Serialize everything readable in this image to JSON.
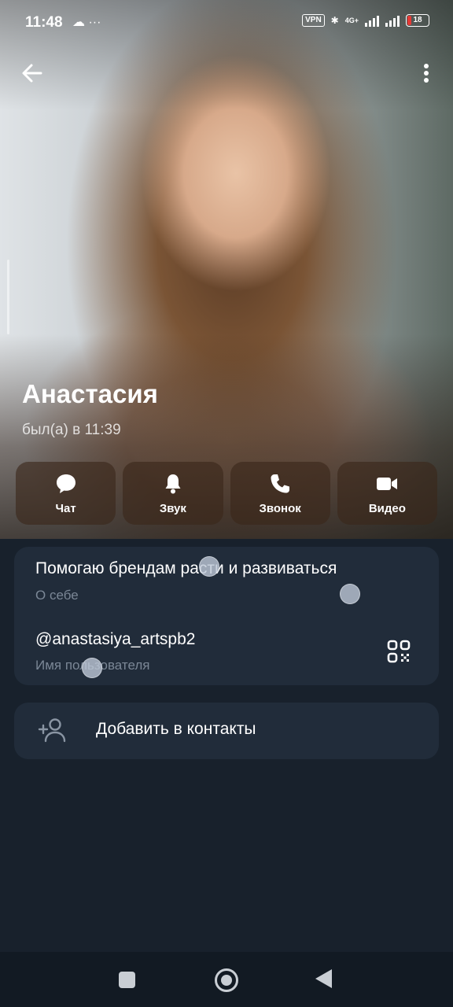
{
  "status_bar": {
    "time": "11:48",
    "left_icons": "☁ ···",
    "vpn": "VPN",
    "network": "4G+",
    "battery": "18"
  },
  "profile": {
    "name": "Анастасия",
    "last_seen": "был(а) в 11:39"
  },
  "actions": [
    {
      "label": "Чат",
      "icon": "chat-icon"
    },
    {
      "label": "Звук",
      "icon": "bell-icon"
    },
    {
      "label": "Звонок",
      "icon": "phone-icon"
    },
    {
      "label": "Видео",
      "icon": "video-icon"
    }
  ],
  "info": {
    "bio": "Помогаю брендам расти и развиваться",
    "bio_label": "О себе",
    "username": "@anastasiya_artspb2",
    "username_label": "Имя пользователя"
  },
  "add_contact": {
    "label": "Добавить в контакты",
    "icon": "add-person-icon"
  },
  "colors": {
    "background": "#18212c",
    "card": "#212c3a",
    "secondary_text": "#7b8796"
  }
}
